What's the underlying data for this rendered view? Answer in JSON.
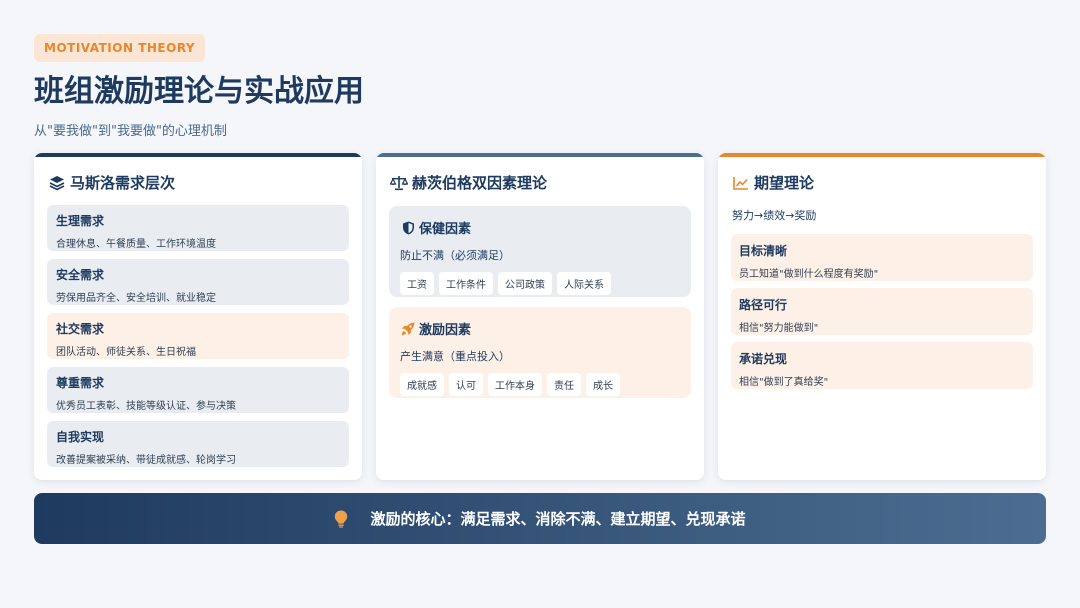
{
  "header": {
    "tag": "MOTIVATION THEORY",
    "title": "班组激励理论与实战应用",
    "subtitle": "从\"要我做\"到\"我要做\"的心理机制"
  },
  "colors": {
    "navy": "#1e3a5f",
    "accent": "#e8862d",
    "steel": "#4c6d91"
  },
  "maslow": {
    "title": "马斯洛需求层次",
    "icon": "layers-icon",
    "items": [
      {
        "h": "生理需求",
        "d": "合理休息、午餐质量、工作环境温度",
        "tone": "gray"
      },
      {
        "h": "安全需求",
        "d": "劳保用品齐全、安全培训、就业稳定",
        "tone": "gray"
      },
      {
        "h": "社交需求",
        "d": "团队活动、师徒关系、生日祝福",
        "tone": "orange"
      },
      {
        "h": "尊重需求",
        "d": "优秀员工表彰、技能等级认证、参与决策",
        "tone": "gray"
      },
      {
        "h": "自我实现",
        "d": "改善提案被采纳、带徒成就感、轮岗学习",
        "tone": "gray"
      }
    ]
  },
  "herzberg": {
    "title": "赫茨伯格双因素理论",
    "icon": "scale-icon",
    "hygiene": {
      "title": "保健因素",
      "icon": "shield-icon",
      "desc": "防止不满（必须满足）",
      "chips": [
        "工资",
        "工作条件",
        "公司政策",
        "人际关系"
      ]
    },
    "motivator": {
      "title": "激励因素",
      "icon": "rocket-icon",
      "desc": "产生满意（重点投入）",
      "chips": [
        "成就感",
        "认可",
        "工作本身",
        "责任",
        "成长"
      ]
    }
  },
  "expectancy": {
    "title": "期望理论",
    "icon": "chart-line-icon",
    "subtitle": "努力→绩效→奖励",
    "items": [
      {
        "h": "目标清晰",
        "d": "员工知道\"做到什么程度有奖励\""
      },
      {
        "h": "路径可行",
        "d": "相信\"努力能做到\""
      },
      {
        "h": "承诺兑现",
        "d": "相信\"做到了真给奖\""
      }
    ]
  },
  "banner": {
    "icon": "lightbulb-icon",
    "text": "激励的核心：满足需求、消除不满、建立期望、兑现承诺"
  }
}
